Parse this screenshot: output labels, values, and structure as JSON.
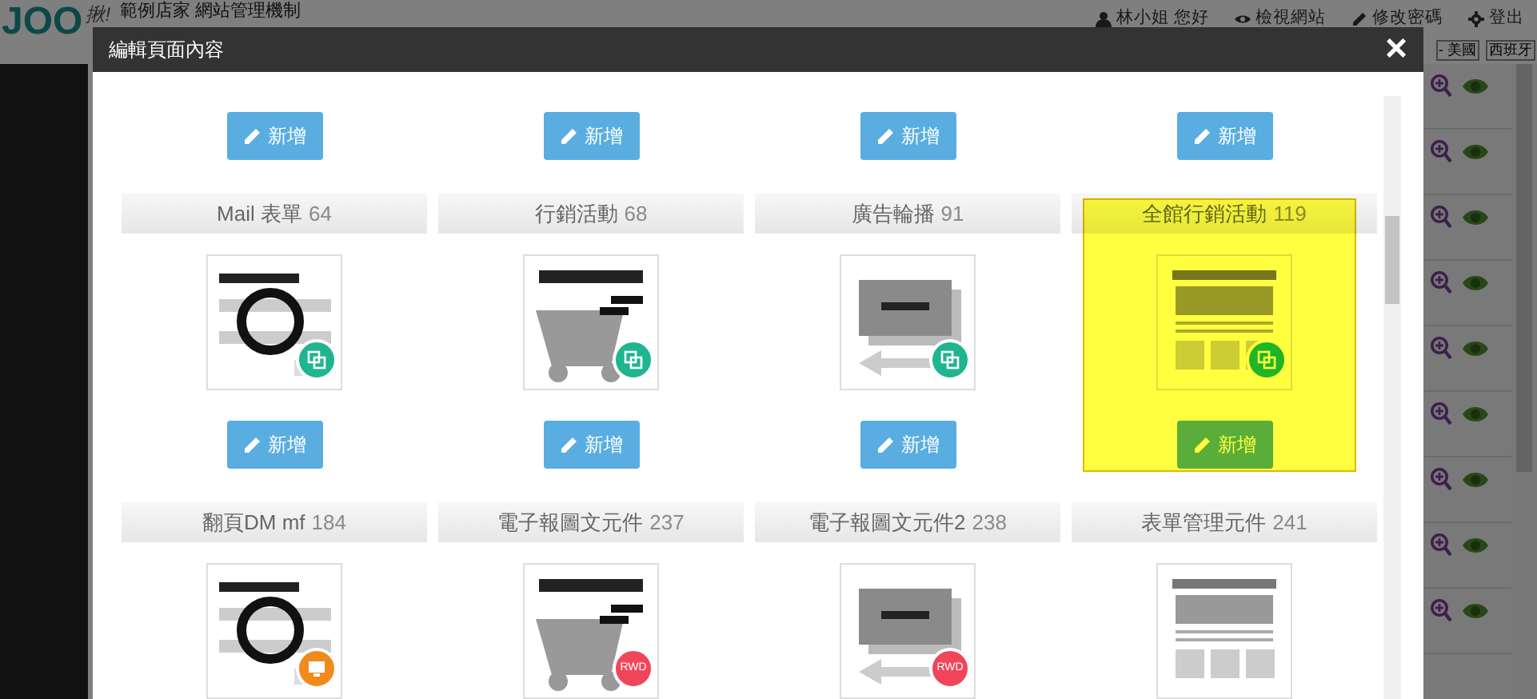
{
  "header": {
    "logo": "JOO",
    "logo_suffix": "揪!",
    "site_title": "範例店家 網站管理機制",
    "links": [
      {
        "label": "林小姐 您好"
      },
      {
        "label": "檢視網站"
      },
      {
        "label": "修改密碼"
      },
      {
        "label": "登出"
      }
    ]
  },
  "languages": [
    "- 美國",
    "西班牙"
  ],
  "modal": {
    "title": "編輯頁面內容",
    "close": "×",
    "top_buttons": [
      "新增",
      "新增",
      "新增",
      "新增"
    ],
    "items": [
      {
        "title": "Mail 表單",
        "number": "64",
        "badge": {
          "kind": "copy"
        },
        "button": "新增",
        "highlighted": false
      },
      {
        "title": "行銷活動",
        "number": "68",
        "badge": {
          "kind": "copy"
        },
        "button": "新增",
        "highlighted": false
      },
      {
        "title": "廣告輪播",
        "number": "91",
        "badge": {
          "kind": "copy"
        },
        "button": "新增",
        "highlighted": false
      },
      {
        "title": "全館行銷活動",
        "number": "119",
        "badge": {
          "kind": "copy"
        },
        "button": "新增",
        "highlighted": true
      },
      {
        "title": "翻頁DM mf",
        "number": "184",
        "badge": {
          "kind": "desktop"
        },
        "highlighted": false
      },
      {
        "title": "電子報圖文元件",
        "number": "237",
        "badge": {
          "kind": "rwd",
          "label": "RWD"
        },
        "highlighted": false
      },
      {
        "title": "電子報圖文元件2",
        "number": "238",
        "badge": {
          "kind": "rwd",
          "label": "RWD"
        },
        "highlighted": false
      },
      {
        "title": "表單管理元件",
        "number": "241",
        "highlighted": false
      }
    ]
  }
}
